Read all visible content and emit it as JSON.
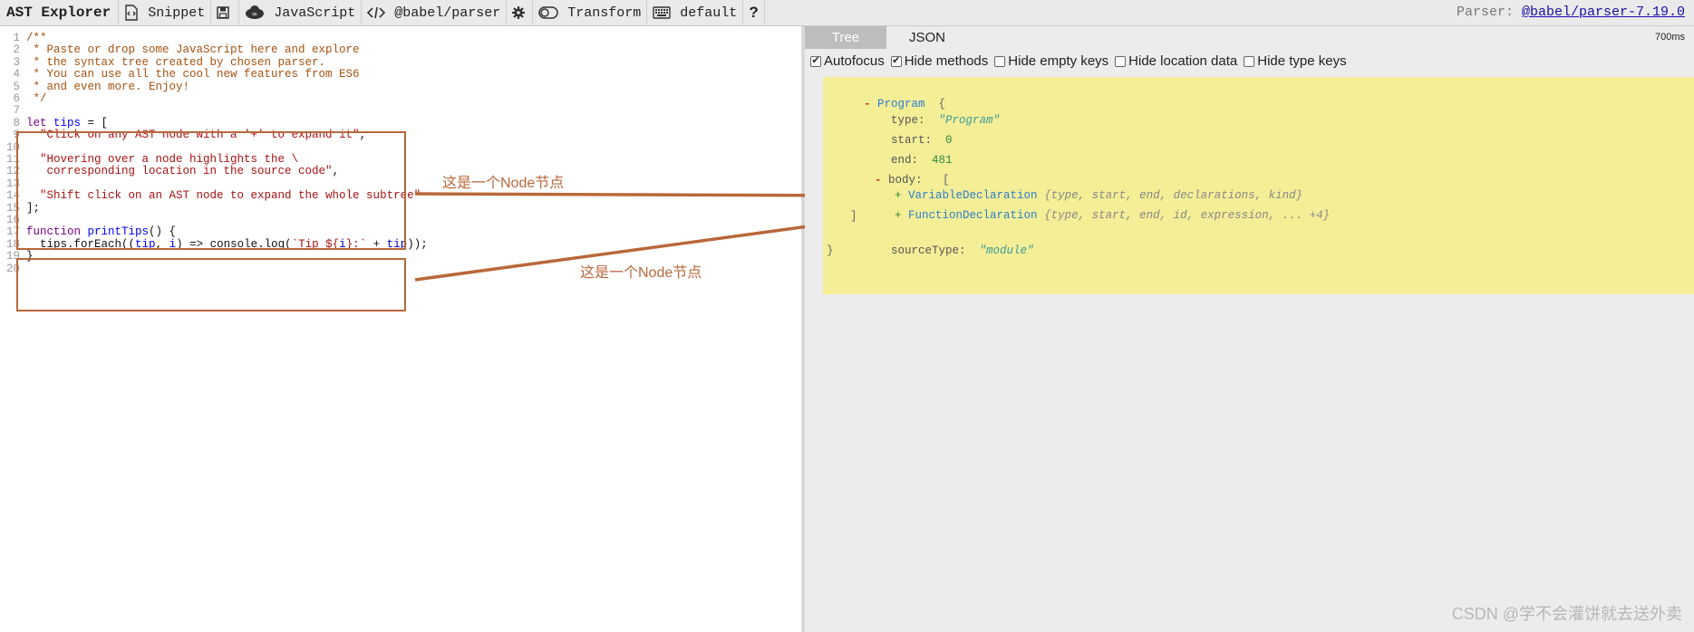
{
  "toolbar": {
    "title": "AST Explorer",
    "snippet": "Snippet",
    "language": "JavaScript",
    "parser": "@babel/parser",
    "transform": "Transform",
    "keymap": "default",
    "help": "?",
    "parser_label": "Parser:",
    "parser_link": "@babel/parser-7.19.0"
  },
  "editor": {
    "lines": [
      {
        "n": "1",
        "parts": [
          {
            "c": "c-comment",
            "t": "/**"
          }
        ]
      },
      {
        "n": "2",
        "parts": [
          {
            "c": "c-comment",
            "t": " * Paste or drop some JavaScript here and explore"
          }
        ]
      },
      {
        "n": "3",
        "parts": [
          {
            "c": "c-comment",
            "t": " * the syntax tree created by chosen parser."
          }
        ]
      },
      {
        "n": "4",
        "parts": [
          {
            "c": "c-comment",
            "t": " * You can use all the cool new features from ES6"
          }
        ]
      },
      {
        "n": "5",
        "parts": [
          {
            "c": "c-comment",
            "t": " * and even more. Enjoy!"
          }
        ]
      },
      {
        "n": "6",
        "parts": [
          {
            "c": "c-comment",
            "t": " */"
          }
        ]
      },
      {
        "n": "7",
        "parts": []
      },
      {
        "n": "8",
        "parts": [
          {
            "c": "c-kw",
            "t": "let "
          },
          {
            "c": "c-def",
            "t": "tips"
          },
          {
            "c": "c-plain",
            "t": " = ["
          }
        ]
      },
      {
        "n": "9",
        "parts": [
          {
            "c": "c-str",
            "t": "  \"Click on any AST node with a '+' to expand it\""
          },
          {
            "c": "c-plain",
            "t": ","
          }
        ]
      },
      {
        "n": "10",
        "parts": []
      },
      {
        "n": "11",
        "parts": [
          {
            "c": "c-str",
            "t": "  \"Hovering over a node highlights the \\"
          }
        ]
      },
      {
        "n": "12",
        "parts": [
          {
            "c": "c-str",
            "t": "   corresponding location in the source code\""
          },
          {
            "c": "c-plain",
            "t": ","
          }
        ]
      },
      {
        "n": "13",
        "parts": []
      },
      {
        "n": "14",
        "parts": [
          {
            "c": "c-str",
            "t": "  \"Shift click on an AST node to expand the whole subtree\""
          }
        ]
      },
      {
        "n": "15",
        "parts": [
          {
            "c": "c-plain",
            "t": "];"
          }
        ]
      },
      {
        "n": "16",
        "parts": []
      },
      {
        "n": "17",
        "parts": [
          {
            "c": "c-kw",
            "t": "function "
          },
          {
            "c": "c-def",
            "t": "printTips"
          },
          {
            "c": "c-plain",
            "t": "() {"
          }
        ]
      },
      {
        "n": "18",
        "parts": [
          {
            "c": "c-plain",
            "t": "  tips.forEach(("
          },
          {
            "c": "c-def",
            "t": "tip"
          },
          {
            "c": "c-plain",
            "t": ", "
          },
          {
            "c": "c-def",
            "t": "i"
          },
          {
            "c": "c-plain",
            "t": ") => console.log("
          },
          {
            "c": "c-str",
            "t": "`Tip ${"
          },
          {
            "c": "c-var",
            "t": "i"
          },
          {
            "c": "c-str",
            "t": "}:`"
          },
          {
            "c": "c-plain",
            "t": " + "
          },
          {
            "c": "c-var",
            "t": "tip"
          },
          {
            "c": "c-plain",
            "t": "));"
          }
        ]
      },
      {
        "n": "19",
        "parts": [
          {
            "c": "c-plain",
            "t": "}"
          }
        ]
      },
      {
        "n": "20",
        "parts": []
      }
    ]
  },
  "annotations": {
    "top": "这是一个Node节点",
    "bottom": "这是一个Node节点",
    "color": "#b8683a"
  },
  "output": {
    "tabs": [
      "Tree",
      "JSON"
    ],
    "timing": "700ms",
    "options": [
      {
        "label": "Autofocus",
        "checked": true
      },
      {
        "label": "Hide methods",
        "checked": true
      },
      {
        "label": "Hide empty keys",
        "checked": false
      },
      {
        "label": "Hide location data",
        "checked": false
      },
      {
        "label": "Hide type keys",
        "checked": false
      }
    ],
    "tree": {
      "root": "Program",
      "type_key": "type:",
      "type_val": "\"Program\"",
      "start_key": "start:",
      "start_val": "0",
      "end_key": "end:",
      "end_val": "481",
      "body_key": "body:",
      "children": [
        {
          "name": "VariableDeclaration",
          "summary": "{type, start, end, declarations, kind}"
        },
        {
          "name": "FunctionDeclaration",
          "summary": "{type, start, end, id, expression, ... +4}"
        }
      ],
      "source_key": "sourceType:",
      "source_val": "\"module\""
    },
    "highlight_color": "#f4ee96"
  },
  "watermark": "CSDN @学不会灌饼就去送外卖"
}
